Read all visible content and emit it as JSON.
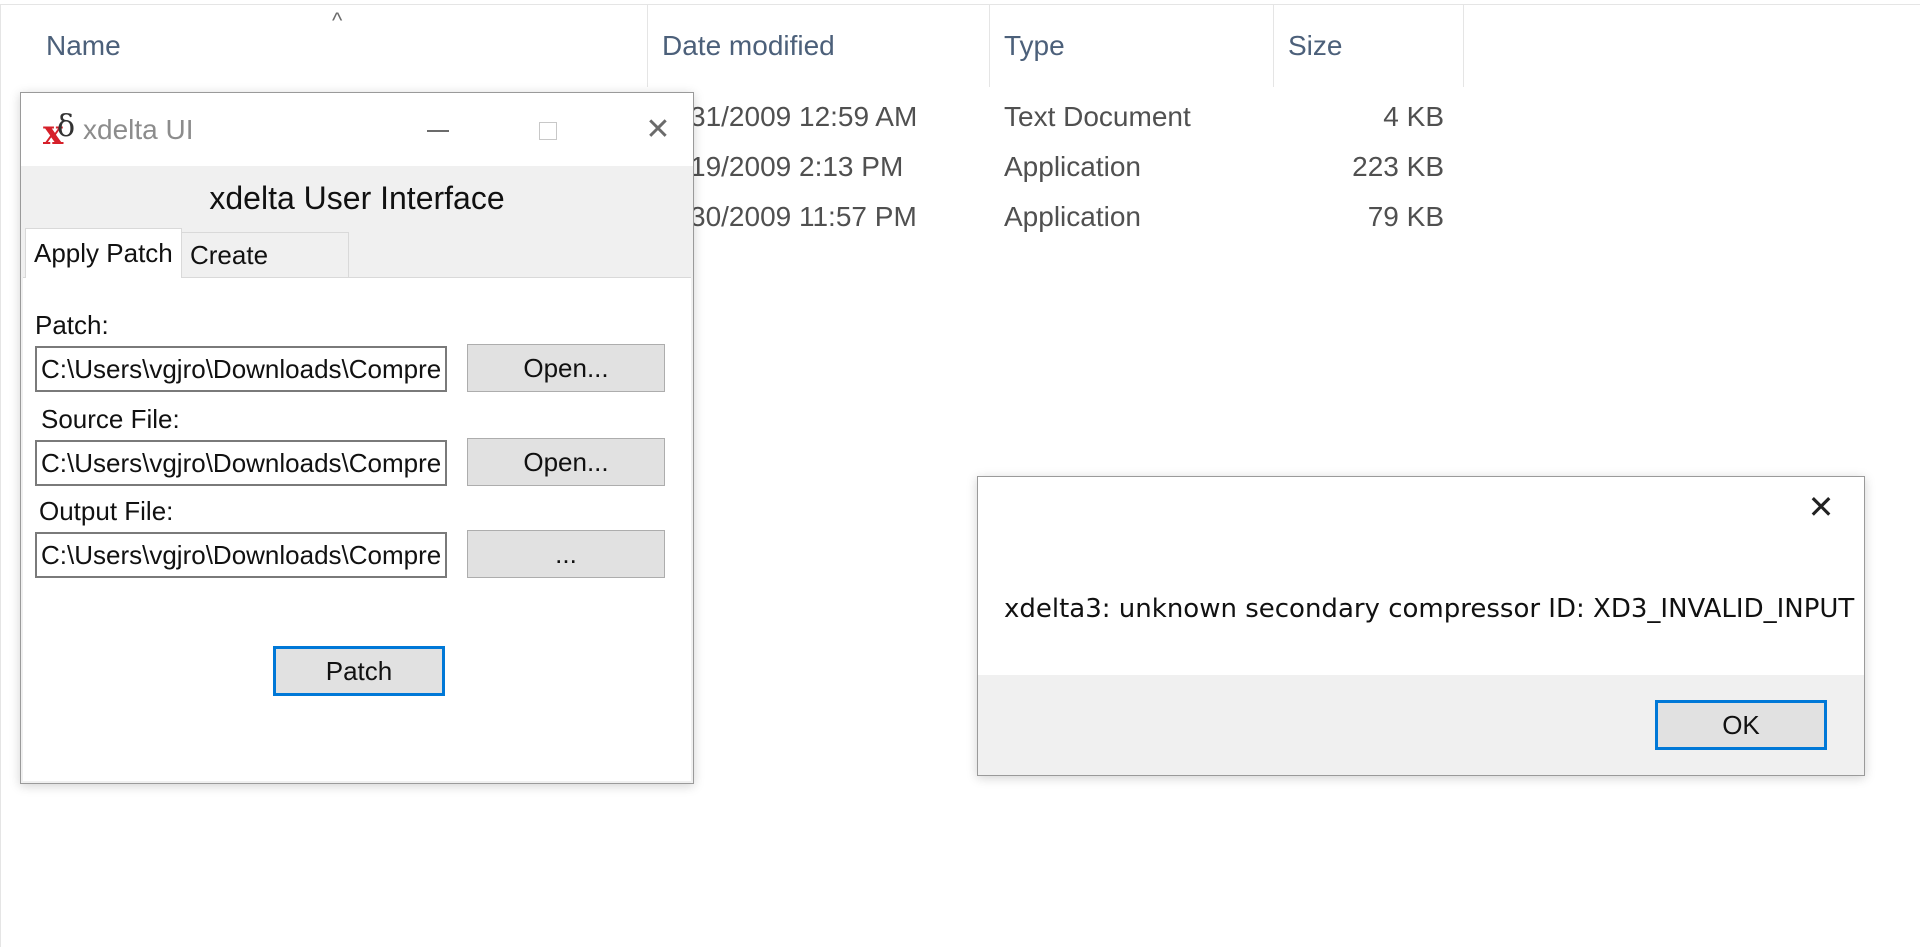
{
  "explorer": {
    "columns": {
      "name": "Name",
      "date": "Date modified",
      "type": "Type",
      "size": "Size"
    },
    "sort_indicator": "^",
    "rows": [
      {
        "date": "31/2009 12:59 AM",
        "type": "Text Document",
        "size": "4 KB"
      },
      {
        "date": "19/2009 2:13 PM",
        "type": "Application",
        "size": "223 KB"
      },
      {
        "date": "30/2009 11:57 PM",
        "type": "Application",
        "size": "79 KB"
      }
    ]
  },
  "xdelta": {
    "title": "xdelta UI",
    "logo": {
      "x": "x",
      "delta": "δ"
    },
    "window_controls": {
      "minimize": "—",
      "maximize": "☐",
      "close": "✕"
    },
    "heading": "xdelta User Interface",
    "tabs": [
      {
        "label": "Apply Patch",
        "active": true
      },
      {
        "label": "Create Patch",
        "active": false
      }
    ],
    "fields": {
      "patch": {
        "label": "Patch:",
        "value": "C:\\Users\\vgjro\\Downloads\\Compre",
        "button": "Open..."
      },
      "source": {
        "label": "Source File:",
        "value": "C:\\Users\\vgjro\\Downloads\\Compre",
        "button": "Open..."
      },
      "output": {
        "label": "Output File:",
        "value": "C:\\Users\\vgjro\\Downloads\\Compre",
        "button": "..."
      }
    },
    "patch_button": "Patch"
  },
  "dialog": {
    "close": "✕",
    "message": "xdelta3: unknown secondary compressor ID: XD3_INVALID_INPUT",
    "ok_button": "OK"
  },
  "colors": {
    "accent": "#0078d7",
    "logo_red": "#d6202a",
    "header_text": "#4c607a"
  }
}
